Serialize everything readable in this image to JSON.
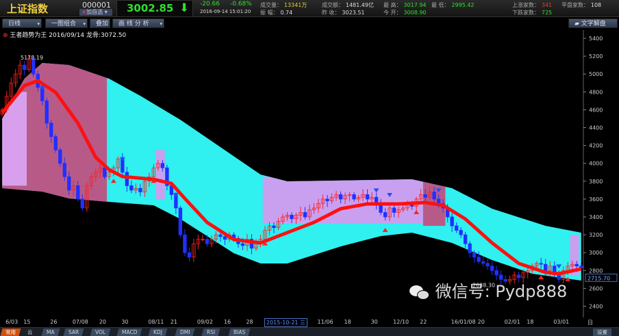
{
  "header": {
    "name": "上证指数",
    "code": "000001",
    "add_watch": "加自选",
    "price": "3002.85",
    "change": "-20.66",
    "change_pct": "-0.68%",
    "timestamp": "2016-09-14 15:01:20",
    "stats": [
      {
        "label": "成交量：",
        "value": "13341万",
        "color": "#e0d040"
      },
      {
        "label": "振 幅：",
        "value": "0.74",
        "color": "#dddddd"
      },
      {
        "label": "成交额：",
        "value": "1481.49亿",
        "color": "#dddddd"
      },
      {
        "label": "昨 收：",
        "value": "3023.51",
        "color": "#dddddd"
      },
      {
        "label": "最 高：",
        "value": "3017.94",
        "color": "#2ee02e"
      },
      {
        "label": "今 开：",
        "value": "3008.90",
        "color": "#2ee02e"
      },
      {
        "label": "最 低：",
        "value": "2995.42",
        "color": "#2ee02e"
      },
      {
        "label": "上涨家数：",
        "value": "341",
        "color": "#ff3030"
      },
      {
        "label": "下跌家数：",
        "value": "725",
        "color": "#2ee02e"
      },
      {
        "label": "平盘家数：",
        "value": "108",
        "color": "#dddddd"
      }
    ]
  },
  "toolbar": {
    "period": "日线",
    "combo": "一图组合",
    "overlay": "叠加",
    "draw": "画 线 分 析",
    "text_analysis": "文字解盘"
  },
  "indicator_title": "王者趋势为王 2016/09/14 龙骨:3072.50",
  "chart_data": {
    "type": "candlestick",
    "y_ticks": [
      5400,
      5200,
      5000,
      4800,
      4600,
      4400,
      4200,
      4000,
      3800,
      3600,
      3400,
      3200,
      3000,
      2800,
      2600,
      2400
    ],
    "ylim": [
      2400,
      5400
    ],
    "x_ticks": [
      {
        "slot": 2,
        "label": "6/03"
      },
      {
        "slot": 6,
        "label": "15"
      },
      {
        "slot": 12,
        "label": "26"
      },
      {
        "slot": 17,
        "label": "07/08"
      },
      {
        "slot": 23,
        "label": "20"
      },
      {
        "slot": 28,
        "label": "30"
      },
      {
        "slot": 34,
        "label": "08/11"
      },
      {
        "slot": 39,
        "label": "21"
      },
      {
        "slot": 45,
        "label": "09/02"
      },
      {
        "slot": 51,
        "label": "16"
      },
      {
        "slot": 56,
        "label": "28"
      },
      {
        "slot": 72,
        "label": "11/06"
      },
      {
        "slot": 78,
        "label": "18"
      },
      {
        "slot": 84,
        "label": "30"
      },
      {
        "slot": 89,
        "label": "12/10"
      },
      {
        "slot": 95,
        "label": "22"
      },
      {
        "slot": 102,
        "label": "16/01/08"
      },
      {
        "slot": 108,
        "label": "20"
      },
      {
        "slot": 114,
        "label": "02/01"
      },
      {
        "slot": 119,
        "label": "18"
      },
      {
        "slot": 125,
        "label": "03/01"
      }
    ],
    "cursor_date": "2015-10-21 三",
    "period_label": "日线",
    "closes": [
      4600,
      4750,
      4900,
      5000,
      5100,
      5050,
      5170,
      5000,
      4850,
      4700,
      4450,
      4300,
      4150,
      4000,
      3850,
      3700,
      3750,
      3600,
      3500,
      3750,
      3850,
      3900,
      3950,
      3850,
      3900,
      3950,
      4050,
      3900,
      3750,
      3700,
      3720,
      3680,
      3800,
      3850,
      3950,
      4000,
      3950,
      3750,
      3650,
      3500,
      3200,
      3000,
      2950,
      3100,
      3150,
      3150,
      3100,
      3150,
      3200,
      3180,
      3150,
      3200,
      3160,
      3100,
      3080,
      3150,
      3050,
      3100,
      3150,
      3250,
      3300,
      3280,
      3350,
      3400,
      3420,
      3380,
      3420,
      3450,
      3400,
      3480,
      3500,
      3550,
      3600,
      3580,
      3620,
      3650,
      3600,
      3640,
      3650,
      3600,
      3620,
      3650,
      3600,
      3620,
      3550,
      3450,
      3400,
      3500,
      3450,
      3480,
      3500,
      3550,
      3520,
      3600,
      3650,
      3620,
      3680,
      3600,
      3550,
      3500,
      3400,
      3300,
      3250,
      3200,
      3100,
      3000,
      2950,
      2900,
      2880,
      2850,
      2800,
      2750,
      2700,
      2680,
      2700,
      2750,
      2720,
      2780,
      2800,
      2850,
      2880,
      2870,
      2800,
      2850,
      2750,
      2700,
      2800,
      2850,
      2870,
      2850,
      2830
    ],
    "ma": [
      [
        0,
        4565
      ],
      [
        5,
        4871
      ],
      [
        8,
        4925
      ],
      [
        12,
        4795
      ],
      [
        17,
        4450
      ],
      [
        21,
        4067
      ],
      [
        24,
        3929
      ],
      [
        27,
        3852
      ],
      [
        34,
        3821
      ],
      [
        38,
        3775
      ],
      [
        41,
        3607
      ],
      [
        46,
        3339
      ],
      [
        52,
        3147
      ],
      [
        58,
        3109
      ],
      [
        64,
        3224
      ],
      [
        70,
        3339
      ],
      [
        76,
        3492
      ],
      [
        82,
        3546
      ],
      [
        89,
        3546
      ],
      [
        95,
        3561
      ],
      [
        99,
        3530
      ],
      [
        104,
        3377
      ],
      [
        110,
        3109
      ],
      [
        116,
        2879
      ],
      [
        122,
        2779
      ],
      [
        125,
        2764
      ],
      [
        130,
        2818
      ]
    ],
    "band_upper": [
      [
        0,
        4500
      ],
      [
        5,
        4950
      ],
      [
        9,
        5124
      ],
      [
        15,
        5101
      ],
      [
        24,
        4948
      ],
      [
        31,
        4756
      ],
      [
        40,
        4488
      ],
      [
        49,
        4182
      ],
      [
        58,
        3875
      ],
      [
        64,
        3798
      ],
      [
        92,
        3821
      ],
      [
        101,
        3722
      ],
      [
        110,
        3492
      ],
      [
        122,
        3300
      ],
      [
        130,
        3224
      ]
    ],
    "band_lower": [
      [
        0,
        3722
      ],
      [
        9,
        3684
      ],
      [
        15,
        3607
      ],
      [
        24,
        3569
      ],
      [
        34,
        3530
      ],
      [
        40,
        3377
      ],
      [
        46,
        3185
      ],
      [
        52,
        2994
      ],
      [
        58,
        2879
      ],
      [
        64,
        2879
      ],
      [
        76,
        3070
      ],
      [
        85,
        3185
      ],
      [
        92,
        3224
      ],
      [
        101,
        3109
      ],
      [
        110,
        2917
      ],
      [
        119,
        2764
      ],
      [
        130,
        2687
      ]
    ],
    "zones": [
      {
        "from": 0,
        "to": 24,
        "high": 5400,
        "low": 2400,
        "color": "#b85a88"
      },
      {
        "from": 0,
        "to": 6,
        "high": 4800,
        "low": 3750,
        "color": "#d8a0ec"
      },
      {
        "from": 35,
        "to": 37,
        "high": 4150,
        "low": 3600,
        "color": "#c9a0f0"
      },
      {
        "from": 59,
        "to": 95,
        "high": 3850,
        "low": 3330,
        "color": "#c9a0f0"
      },
      {
        "from": 95,
        "to": 100,
        "high": 3850,
        "low": 3300,
        "color": "#b85a88"
      },
      {
        "from": 128,
        "to": 130,
        "high": 3200,
        "low": 2750,
        "color": "#c9a0f0"
      }
    ],
    "sell_signals": [
      9,
      27,
      39,
      84,
      87,
      98,
      125
    ],
    "buy_signals": [
      25,
      34,
      59,
      86,
      93,
      121,
      127
    ],
    "max_label": "5178.19",
    "min_label": "2638.30",
    "last_label": "2715.70"
  },
  "watermark": "微信号: Pydp888",
  "bottom_tabs": [
    "常用",
    "云",
    "MA",
    "SAR",
    "VOL",
    "MACD",
    "KDJ",
    "DMI",
    "RSI",
    "BIAS"
  ],
  "settings": "设置"
}
